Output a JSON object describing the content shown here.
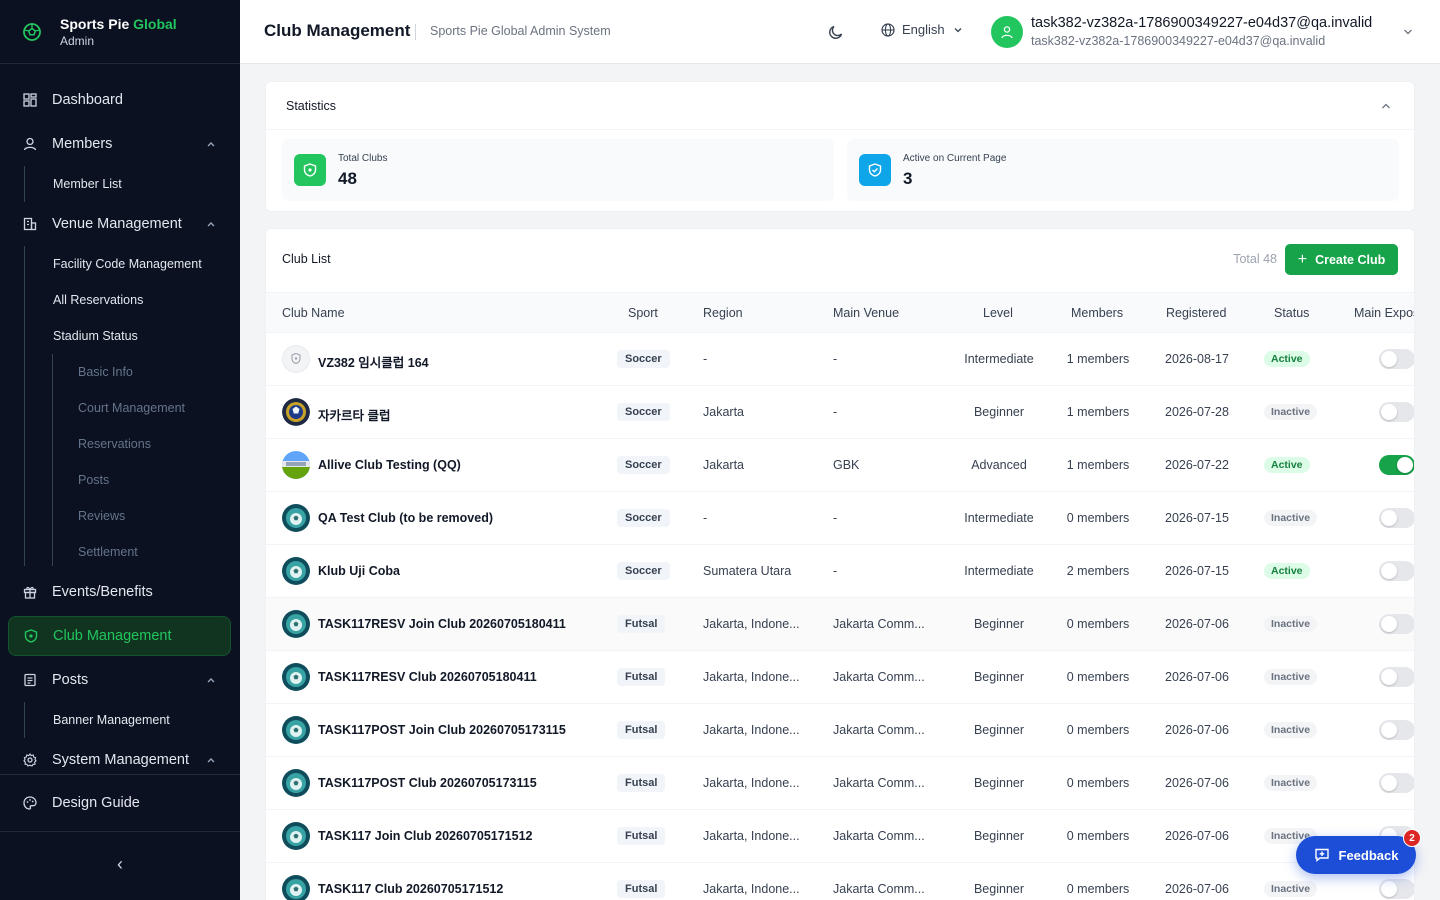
{
  "brand": {
    "name_main": "Sports Pie ",
    "name_accent": "Global",
    "role": "Admin"
  },
  "sidebar": {
    "dashboard": "Dashboard",
    "members": "Members",
    "member_list": "Member List",
    "venue_management": "Venue Management",
    "facility_code": "Facility Code Management",
    "all_reservations": "All Reservations",
    "stadium_status": "Stadium Status",
    "stadium_sub": [
      "Basic Info",
      "Court Management",
      "Reservations",
      "Posts",
      "Reviews",
      "Settlement"
    ],
    "events_benefits": "Events/Benefits",
    "club_management": "Club Management",
    "posts": "Posts",
    "banner_management": "Banner Management",
    "system_management": "System Management",
    "design_guide": "Design Guide",
    "collapse_symbol": "‹"
  },
  "header": {
    "title": "Club Management",
    "subtitle": "Sports Pie Global Admin System",
    "language": "English",
    "user_name": "task382-vz382a-1786900349227-e04d37@qa.invalid",
    "user_email": "task382-vz382a-1786900349227-e04d37@qa.invalid"
  },
  "stats": {
    "title": "Statistics",
    "total_clubs_label": "Total Clubs",
    "total_clubs_value": "48",
    "active_label": "Active on Current Page",
    "active_value": "3"
  },
  "club_list": {
    "title": "Club List",
    "total": "Total 48",
    "create_button": "Create Club",
    "columns": {
      "name": "Club Name",
      "sport": "Sport",
      "region": "Region",
      "venue": "Main Venue",
      "level": "Level",
      "members": "Members",
      "registered": "Registered",
      "status": "Status",
      "exposure": "Main Expos"
    },
    "rows": [
      {
        "name": "VZ382 임시클럽 164",
        "sport": "Soccer",
        "region": "-",
        "venue": "-",
        "level": "Intermediate",
        "members": "1 members",
        "registered": "2026-08-17",
        "status": "Active",
        "main_exposure": false,
        "avatar": "placeholder"
      },
      {
        "name": "자카르타 클럽",
        "sport": "Soccer",
        "region": "Jakarta",
        "venue": "-",
        "level": "Beginner",
        "members": "1 members",
        "registered": "2026-07-28",
        "status": "Inactive",
        "main_exposure": false,
        "avatar": "crest"
      },
      {
        "name": "Allive Club Testing (QQ)",
        "sport": "Soccer",
        "region": "Jakarta",
        "venue": "GBK",
        "level": "Advanced",
        "members": "1 members",
        "registered": "2026-07-22",
        "status": "Active",
        "main_exposure": true,
        "avatar": "field"
      },
      {
        "name": "QA Test Club (to be removed)",
        "sport": "Soccer",
        "region": "-",
        "venue": "-",
        "level": "Intermediate",
        "members": "0 members",
        "registered": "2026-07-15",
        "status": "Inactive",
        "main_exposure": false,
        "avatar": "ball"
      },
      {
        "name": "Klub Uji Coba",
        "sport": "Soccer",
        "region": "Sumatera Utara",
        "venue": "-",
        "level": "Intermediate",
        "members": "2 members",
        "registered": "2026-07-15",
        "status": "Active",
        "main_exposure": false,
        "avatar": "ball"
      },
      {
        "name": "TASK117RESV Join Club 20260705180411",
        "sport": "Futsal",
        "region": "Jakarta, Indone...",
        "venue": "Jakarta Comm...",
        "level": "Beginner",
        "members": "0 members",
        "registered": "2026-07-06",
        "status": "Inactive",
        "main_exposure": false,
        "avatar": "ball"
      },
      {
        "name": "TASK117RESV Club 20260705180411",
        "sport": "Futsal",
        "region": "Jakarta, Indone...",
        "venue": "Jakarta Comm...",
        "level": "Beginner",
        "members": "0 members",
        "registered": "2026-07-06",
        "status": "Inactive",
        "main_exposure": false,
        "avatar": "ball"
      },
      {
        "name": "TASK117POST Join Club 20260705173115",
        "sport": "Futsal",
        "region": "Jakarta, Indone...",
        "venue": "Jakarta Comm...",
        "level": "Beginner",
        "members": "0 members",
        "registered": "2026-07-06",
        "status": "Inactive",
        "main_exposure": false,
        "avatar": "ball"
      },
      {
        "name": "TASK117POST Club 20260705173115",
        "sport": "Futsal",
        "region": "Jakarta, Indone...",
        "venue": "Jakarta Comm...",
        "level": "Beginner",
        "members": "0 members",
        "registered": "2026-07-06",
        "status": "Inactive",
        "main_exposure": false,
        "avatar": "ball"
      },
      {
        "name": "TASK117 Join Club 20260705171512",
        "sport": "Futsal",
        "region": "Jakarta, Indone...",
        "venue": "Jakarta Comm...",
        "level": "Beginner",
        "members": "0 members",
        "registered": "2026-07-06",
        "status": "Inactive",
        "main_exposure": false,
        "avatar": "ball"
      },
      {
        "name": "TASK117 Club 20260705171512",
        "sport": "Futsal",
        "region": "Jakarta, Indone...",
        "venue": "Jakarta Comm...",
        "level": "Beginner",
        "members": "0 members",
        "registered": "2026-07-06",
        "status": "Inactive",
        "main_exposure": false,
        "avatar": "ball"
      }
    ]
  },
  "feedback": {
    "label": "Feedback",
    "badge": "2"
  },
  "colors": {
    "accent": "#22c55e",
    "sidebar_bg": "#0b1120",
    "primary_button": "#16a34a",
    "feedback": "#1d4ed8"
  },
  "icons": {
    "brand": "ball-icon",
    "dashboard": "grid-icon",
    "members": "user-icon",
    "venue": "building-icon",
    "events": "gift-icon",
    "club": "shield-icon",
    "posts": "document-icon",
    "system": "gear-icon",
    "design": "palette-icon",
    "theme": "moon-icon",
    "language": "globe-icon"
  }
}
